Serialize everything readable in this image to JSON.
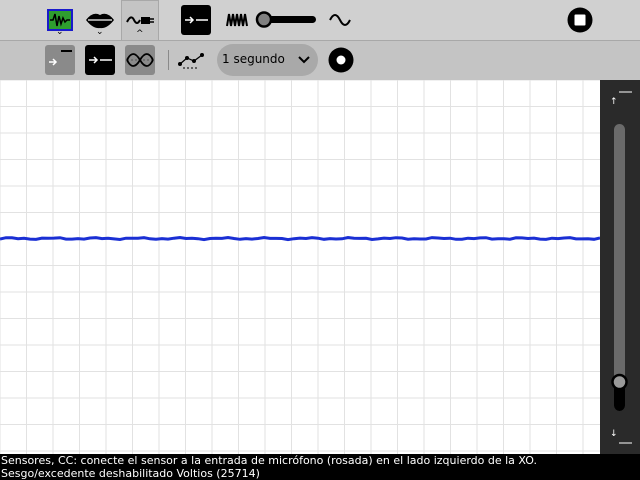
{
  "toolbar_top": {
    "tabs": [
      {
        "name": "oscilloscope-tab",
        "icon": "waveform-display-icon"
      },
      {
        "name": "speech-tab",
        "icon": "lips-icon"
      },
      {
        "name": "sensors-tab",
        "icon": "sensor-plug-icon",
        "active": true
      }
    ],
    "tools": [
      "bias-toggle-icon",
      "frequency-icon",
      "gain-slider",
      "sine-icon",
      "stop-icon"
    ]
  },
  "toolbar_second": {
    "buttons": [
      "dc-bias-icon",
      "ac-mode-icon",
      "waveform-icon",
      "log-data-icon"
    ],
    "interval_select": {
      "value": "1 segundo"
    },
    "record_icon": "record-icon"
  },
  "graph": {
    "trace_color": "#1a2fd4",
    "grid_color": "#e2e2e2",
    "level": 0.25
  },
  "side_slider": {
    "level": 0.0,
    "up_icon": "arrow-up-icon",
    "down_icon": "arrow-down-icon"
  },
  "status": {
    "line1": "Sensores, CC: conecte el sensor a la entrada de micrófono (rosada) en el lado izquierdo de la XO.",
    "line2": "Sesgo/excedente deshabilitado Voltios       (25714)"
  }
}
